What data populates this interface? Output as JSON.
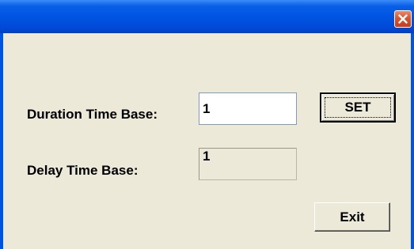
{
  "window": {
    "close_icon": "close-icon"
  },
  "form": {
    "duration_label": "Duration Time Base:",
    "duration_value": "1",
    "delay_label": "Delay Time Base:",
    "delay_value": "1"
  },
  "buttons": {
    "set_label": "SET",
    "exit_label": "Exit"
  },
  "colors": {
    "titlebar": "#0054e3",
    "client_bg": "#ece9d8",
    "close_button": "#d8552f"
  }
}
